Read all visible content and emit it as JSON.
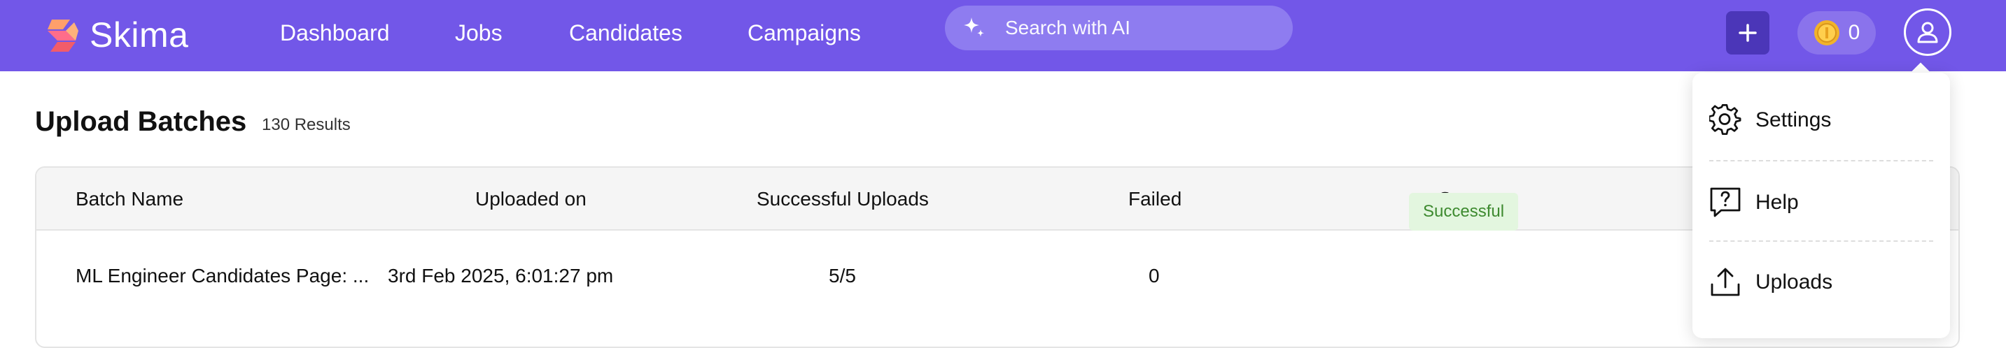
{
  "brand": {
    "name": "Skima"
  },
  "nav": {
    "links": [
      "Dashboard",
      "Jobs",
      "Candidates",
      "Campaigns"
    ]
  },
  "search": {
    "placeholder": "Search with AI",
    "icon": "sparkle-icon"
  },
  "header_actions": {
    "add_icon": "plus-icon",
    "credits": "0",
    "credits_icon": "coin-icon",
    "profile_icon": "user-icon"
  },
  "page": {
    "title": "Upload Batches",
    "result_count": "130 Results"
  },
  "table": {
    "columns": [
      "Batch Name",
      "Uploaded on",
      "Successful Uploads",
      "Failed",
      "Status"
    ],
    "rows": [
      {
        "batch_name": "ML Engineer Candidates Page: ...",
        "uploaded_on": "3rd Feb 2025, 6:01:27 pm",
        "successful_uploads": "5/5",
        "failed": "0",
        "status": "Successful"
      }
    ]
  },
  "profile_menu": {
    "items": [
      {
        "label": "Settings",
        "icon": "gear-icon"
      },
      {
        "label": "Help",
        "icon": "help-icon"
      },
      {
        "label": "Uploads",
        "icon": "upload-icon"
      }
    ]
  },
  "colors": {
    "nav_bg": "#7257e8",
    "search_bg": "#8e7cf0",
    "add_button_bg": "#4b36b8",
    "status_success_bg": "#e3f6df",
    "status_success_text": "#3d8a2f"
  }
}
